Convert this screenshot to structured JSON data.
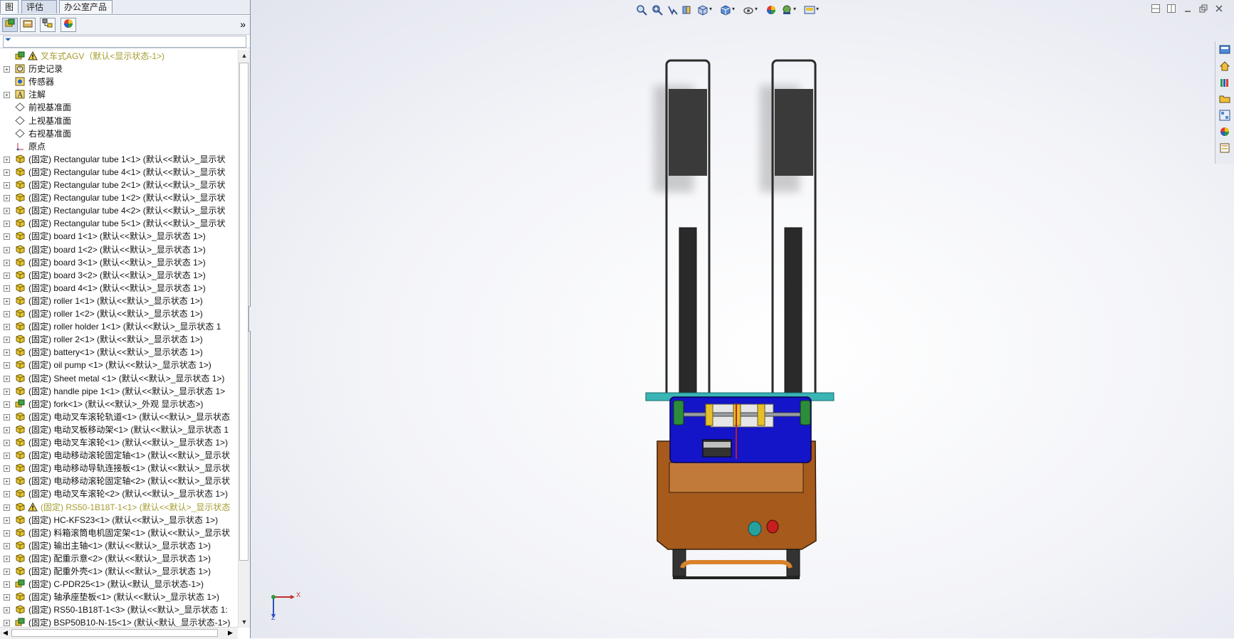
{
  "tabs": [
    {
      "label": "图"
    },
    {
      "label": "评估"
    },
    {
      "label": "办公室产品"
    }
  ],
  "manager_icons": [
    "feature-manager-icon",
    "property-manager-icon",
    "configuration-manager-icon",
    "display-manager-icon"
  ],
  "collapse_glyph": "»",
  "filter_glyph": "⏷",
  "tree": [
    {
      "label": "叉车式AGV（默认<显示状态-1>)",
      "warn": true,
      "icon": "assembly-icon",
      "exp": false
    },
    {
      "label": "历史记录",
      "icon": "history-icon",
      "exp": true
    },
    {
      "label": "传感器",
      "icon": "sensor-icon",
      "exp": false
    },
    {
      "label": "注解",
      "icon": "annotation-icon",
      "exp": true
    },
    {
      "label": "前视基准面",
      "icon": "plane-icon",
      "exp": false
    },
    {
      "label": "上视基准面",
      "icon": "plane-icon",
      "exp": false
    },
    {
      "label": "右视基准面",
      "icon": "plane-icon",
      "exp": false
    },
    {
      "label": "原点",
      "icon": "origin-icon",
      "exp": false
    },
    {
      "label": "(固定) Rectangular tube 1<1> (默认<<默认>_显示状",
      "icon": "part-icon",
      "exp": true
    },
    {
      "label": "(固定) Rectangular tube 4<1> (默认<<默认>_显示状",
      "icon": "part-icon",
      "exp": true
    },
    {
      "label": "(固定) Rectangular tube 2<1> (默认<<默认>_显示状",
      "icon": "part-icon",
      "exp": true
    },
    {
      "label": "(固定) Rectangular tube 1<2> (默认<<默认>_显示状",
      "icon": "part-icon",
      "exp": true
    },
    {
      "label": "(固定) Rectangular tube 4<2> (默认<<默认>_显示状",
      "icon": "part-icon",
      "exp": true
    },
    {
      "label": "(固定) Rectangular tube 5<1> (默认<<默认>_显示状",
      "icon": "part-icon",
      "exp": true
    },
    {
      "label": "(固定) board 1<1> (默认<<默认>_显示状态 1>)",
      "icon": "part-icon",
      "exp": true
    },
    {
      "label": "(固定) board 1<2> (默认<<默认>_显示状态 1>)",
      "icon": "part-icon",
      "exp": true
    },
    {
      "label": "(固定) board 3<1> (默认<<默认>_显示状态 1>)",
      "icon": "part-icon",
      "exp": true
    },
    {
      "label": "(固定) board 3<2> (默认<<默认>_显示状态 1>)",
      "icon": "part-icon",
      "exp": true
    },
    {
      "label": "(固定) board 4<1> (默认<<默认>_显示状态 1>)",
      "icon": "part-icon",
      "exp": true
    },
    {
      "label": "(固定) roller 1<1> (默认<<默认>_显示状态 1>)",
      "icon": "part-icon",
      "exp": true
    },
    {
      "label": "(固定) roller 1<2> (默认<<默认>_显示状态 1>)",
      "icon": "part-icon",
      "exp": true
    },
    {
      "label": "(固定) roller holder 1<1> (默认<<默认>_显示状态 1",
      "icon": "part-icon",
      "exp": true
    },
    {
      "label": "(固定) roller 2<1> (默认<<默认>_显示状态 1>)",
      "icon": "part-icon",
      "exp": true
    },
    {
      "label": "(固定) battery<1> (默认<<默认>_显示状态 1>)",
      "icon": "part-icon",
      "exp": true
    },
    {
      "label": "(固定) oil pump <1> (默认<<默认>_显示状态 1>)",
      "icon": "part-icon",
      "exp": true
    },
    {
      "label": "(固定) Sheet metal <1> (默认<<默认>_显示状态 1>)",
      "icon": "part-icon",
      "exp": true
    },
    {
      "label": "(固定) handle pipe 1<1> (默认<<默认>_显示状态 1>",
      "icon": "part-icon",
      "exp": true
    },
    {
      "label": "(固定) fork<1> (默认<<默认>_外观 显示状态>)",
      "icon": "subassembly-icon",
      "exp": true
    },
    {
      "label": "(固定) 电动叉车滚轮轨道<1> (默认<<默认>_显示状态",
      "icon": "part-icon",
      "exp": true
    },
    {
      "label": "(固定) 电动叉板移动架<1> (默认<<默认>_显示状态 1",
      "icon": "part-icon",
      "exp": true
    },
    {
      "label": "(固定) 电动叉车滚轮<1> (默认<<默认>_显示状态 1>)",
      "icon": "part-icon",
      "exp": true
    },
    {
      "label": "(固定) 电动移动滚轮固定轴<1> (默认<<默认>_显示状",
      "icon": "part-icon",
      "exp": true
    },
    {
      "label": "(固定) 电动移动导轨连接板<1> (默认<<默认>_显示状",
      "icon": "part-icon",
      "exp": true
    },
    {
      "label": "(固定) 电动移动滚轮固定轴<2> (默认<<默认>_显示状",
      "icon": "part-icon",
      "exp": true
    },
    {
      "label": "(固定) 电动叉车滚轮<2> (默认<<默认>_显示状态 1>)",
      "icon": "part-icon",
      "exp": true
    },
    {
      "label": "(固定) RS50-1B18T-1<1> (默认<<默认>_显示状态",
      "icon": "part-icon",
      "exp": true,
      "warn": true,
      "warn_icon": true
    },
    {
      "label": "(固定) HC-KFS23<1> (默认<<默认>_显示状态 1>)",
      "icon": "part-icon",
      "exp": true
    },
    {
      "label": "(固定) 料箱滚筒电机固定架<1> (默认<<默认>_显示状",
      "icon": "part-icon",
      "exp": true
    },
    {
      "label": "(固定) 输出主轴<1> (默认<<默认>_显示状态 1>)",
      "icon": "part-icon",
      "exp": true
    },
    {
      "label": "(固定) 配重示意<2> (默认<<默认>_显示状态 1>)",
      "icon": "part-icon",
      "exp": true
    },
    {
      "label": "(固定) 配重外壳<1> (默认<<默认>_显示状态 1>)",
      "icon": "part-icon",
      "exp": true
    },
    {
      "label": "(固定) C-PDR25<1> (默认<默认_显示状态-1>)",
      "icon": "subassembly-icon",
      "exp": true
    },
    {
      "label": "(固定) 轴承座垫板<1> (默认<<默认>_显示状态 1>)",
      "icon": "part-icon",
      "exp": true
    },
    {
      "label": "(固定) RS50-1B18T-1<3> (默认<<默认>_显示状态 1:",
      "icon": "part-icon",
      "exp": true
    },
    {
      "label": "(固定) BSP50B10-N-15<1> (默认<默认_显示状态-1>)",
      "icon": "subassembly-icon",
      "exp": true
    }
  ],
  "heads_up_icons": [
    "zoom-to-fit-icon",
    "zoom-to-area-icon",
    "previous-view-icon",
    "section-view-icon",
    "view-orientation-icon",
    "display-style-icon",
    "hide-show-items-icon",
    "edit-appearance-icon",
    "apply-scene-icon",
    "view-settings-icon"
  ],
  "window_controls": [
    "tile-horizontal-icon",
    "tile-vertical-icon",
    "minimize-icon",
    "restore-icon",
    "close-icon"
  ],
  "task_pane_icons": [
    "solidworks-resources-icon",
    "home-icon",
    "design-library-icon",
    "file-explorer-icon",
    "view-palette-icon",
    "appearances-icon",
    "custom-properties-icon"
  ],
  "triad": {
    "x_label": "X",
    "z_label": "Z"
  },
  "colors": {
    "fork_dark": "#3a3a3a",
    "frame_cyan": "#3ab4b4",
    "carriage_blue": "#1414c8",
    "body_brown": "#b5682a",
    "handle_orange": "#d9822b",
    "warn_text": "#a59c2f"
  }
}
